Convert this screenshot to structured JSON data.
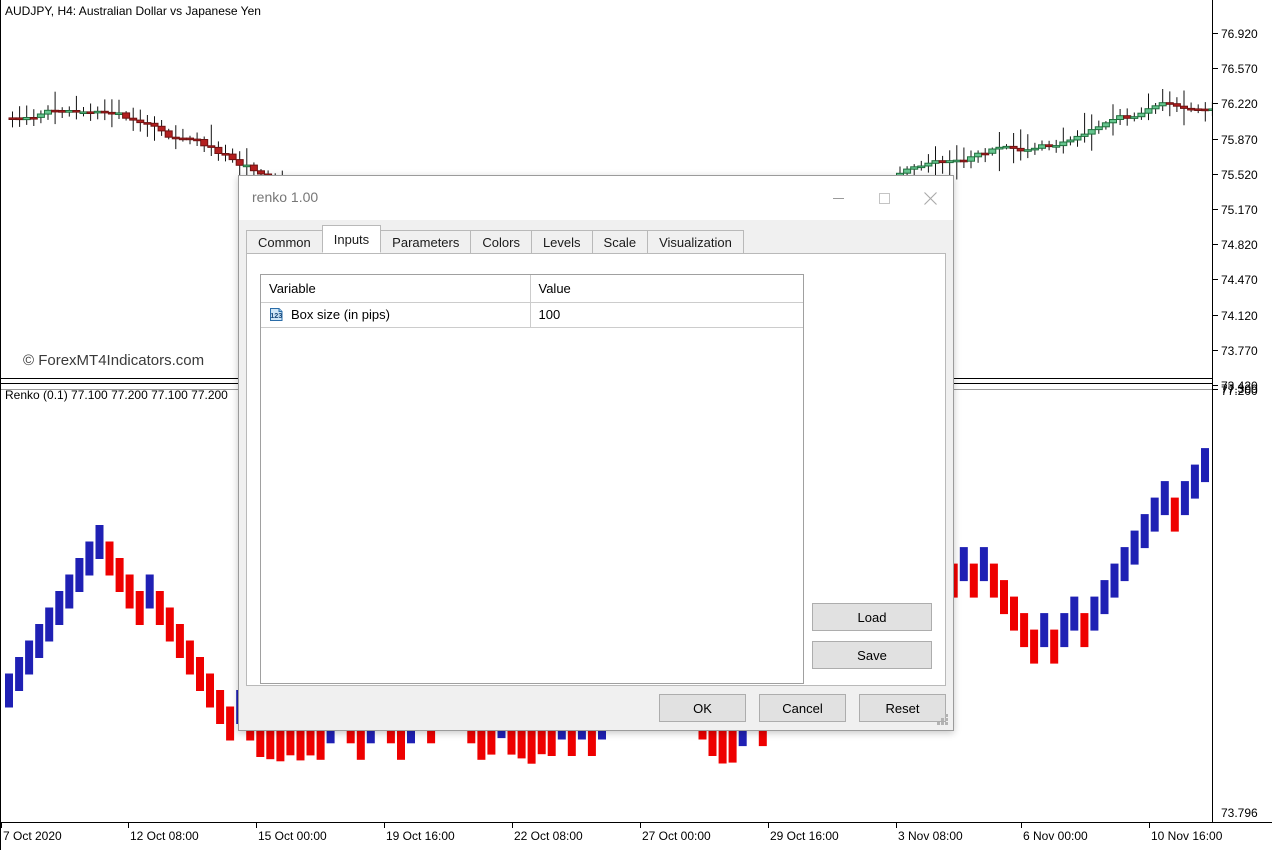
{
  "chart": {
    "title": "AUDJPY, H4:  Australian Dollar vs Japanese Yen",
    "symbol": "AUDJPY",
    "timeframe": "H4",
    "description": "Australian Dollar vs Japanese Yen",
    "watermark": "© ForexMT4Indicators.com",
    "indicator_label": "Renko (0.1) 77.100 77.200 77.100 77.200",
    "price_labels": [
      "76.920",
      "76.570",
      "76.220",
      "75.870",
      "75.520",
      "75.170",
      "74.820",
      "74.470",
      "74.120",
      "73.770",
      "73.420"
    ],
    "sub_price_labels": [
      "77.300",
      "77.200",
      "73.796"
    ],
    "time_labels": [
      "7 Oct 2020",
      "12 Oct 08:00",
      "15 Oct 00:00",
      "19 Oct 16:00",
      "22 Oct 08:00",
      "27 Oct 00:00",
      "29 Oct 16:00",
      "3 Nov 08:00",
      "6 Nov 00:00",
      "10 Nov 16:00"
    ],
    "colors": {
      "bull_body": "#66c68f",
      "bull_border": "#1f6e3c",
      "bear_body": "#b41f1f",
      "bear_border": "#6e1212",
      "renko_up": "#1f20b4",
      "renko_down": "#ee0000",
      "background": "#ffffff",
      "axis": "#000000"
    }
  },
  "dialog": {
    "title": "renko 1.00",
    "window_buttons": [
      {
        "name": "minimize-button",
        "glyph": "minimize"
      },
      {
        "name": "maximize-button",
        "glyph": "maximize"
      },
      {
        "name": "close-button",
        "glyph": "close"
      }
    ],
    "tabs": [
      {
        "label": "Common",
        "active": false
      },
      {
        "label": "Inputs",
        "active": true
      },
      {
        "label": "Parameters",
        "active": false
      },
      {
        "label": "Colors",
        "active": false
      },
      {
        "label": "Levels",
        "active": false
      },
      {
        "label": "Scale",
        "active": false
      },
      {
        "label": "Visualization",
        "active": false
      }
    ],
    "inputs_table": {
      "columns": [
        "Variable",
        "Value"
      ],
      "rows": [
        {
          "icon": "number-123-icon",
          "variable": "Box size (in pips)",
          "value": "100"
        }
      ]
    },
    "side_buttons": {
      "load": "Load",
      "save": "Save"
    },
    "footer_buttons": {
      "ok": "OK",
      "cancel": "Cancel",
      "reset": "Reset"
    }
  },
  "chart_data": {
    "type": "candlestick",
    "title": "AUDJPY, H4:  Australian Dollar vs Japanese Yen",
    "xlabel": "",
    "ylabel": "",
    "ylim": [
      73.42,
      77.1
    ],
    "grid": false,
    "legend": "none",
    "panes": [
      {
        "name": "main-price-pane",
        "type": "candlestick",
        "y_ticks": [
          "76.920",
          "76.570",
          "76.220",
          "75.870",
          "75.520",
          "75.170",
          "74.820",
          "74.470",
          "74.120",
          "73.770",
          "73.420"
        ],
        "series": [
          {
            "name": "AUDJPY H4 OHLC",
            "direction_sequence": "mixed downtrend then uptrend"
          }
        ]
      },
      {
        "name": "renko-indicator-pane",
        "type": "renko",
        "y_ticks": [
          "77.300",
          "77.200",
          "73.796"
        ],
        "series": [
          {
            "name": "Renko (0.1)",
            "last_ohlc": [
              77.1,
              77.2,
              77.1,
              77.2
            ]
          }
        ]
      }
    ],
    "x_ticks": [
      "7 Oct 2020",
      "12 Oct 08:00",
      "15 Oct 00:00",
      "19 Oct 16:00",
      "22 Oct 08:00",
      "27 Oct 00:00",
      "29 Oct 16:00",
      "3 Nov 08:00",
      "6 Nov 00:00",
      "10 Nov 16:00"
    ]
  }
}
